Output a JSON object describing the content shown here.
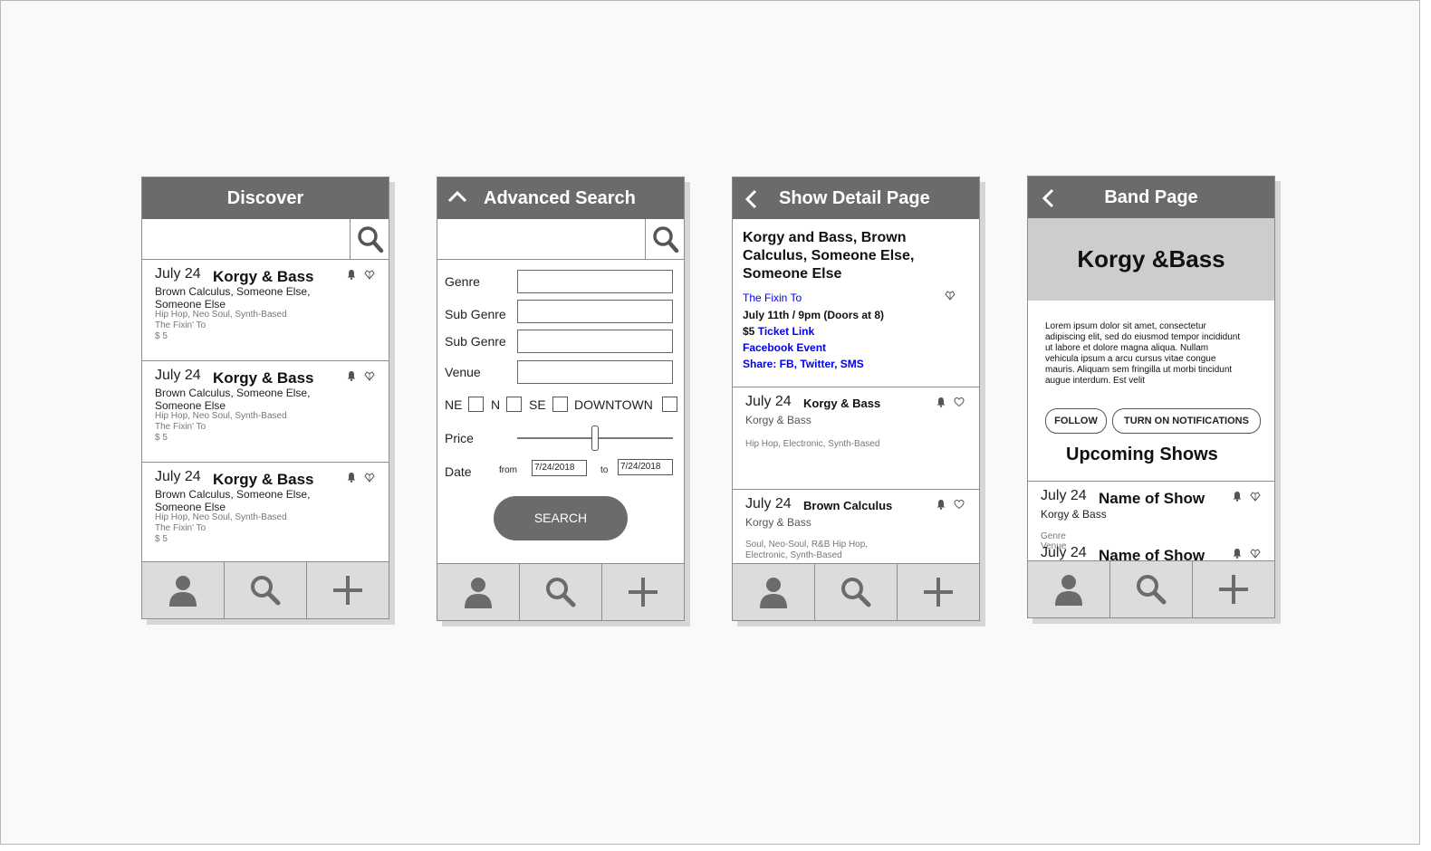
{
  "icons": {
    "search": "search-icon",
    "user": "user-icon",
    "add": "plus-icon",
    "bell": "bell-icon",
    "heart": "heart-icon",
    "back": "chevron-left-icon",
    "collapse": "chevron-up-icon"
  },
  "colors": {
    "header": "#6b6b6b",
    "navbar": "#dcdcdc",
    "link": "#0000ee",
    "band_banner": "#cdcdcd"
  },
  "discover": {
    "title": "Discover",
    "events": [
      {
        "date": "July 24",
        "name": "Korgy & Bass",
        "artists": "Brown Calculus, Someone Else, Someone Else",
        "genres": "Hip Hop, Neo Soul, Synth-Based",
        "venue": "The Fixin' To",
        "price": "$ 5"
      },
      {
        "date": "July 24",
        "name": "Korgy & Bass",
        "artists": "Brown Calculus, Someone Else, Someone Else",
        "genres": "Hip Hop, Neo Soul, Synth-Based",
        "venue": "The Fixin' To",
        "price": "$ 5"
      },
      {
        "date": "July 24",
        "name": "Korgy & Bass",
        "artists": "Brown Calculus, Someone Else, Someone Else",
        "genres": "Hip Hop, Neo Soul, Synth-Based",
        "venue": "The Fixin' To",
        "price": "$ 5"
      }
    ]
  },
  "advanced": {
    "title": "Advanced Search",
    "genre_label": "Genre",
    "subgenre_label": "Sub Genre",
    "subgenre2_label": "Sub Genre",
    "venue_label": "Venue",
    "neighborhoods": [
      "NE",
      "N",
      "SE",
      "DOWNTOWN"
    ],
    "price_label": "Price",
    "price_value": 0.5,
    "date_label": "Date",
    "from_label": "from",
    "to_label": "to",
    "from_value": "7/24/2018",
    "to_value": "7/24/2018",
    "search_label": "SEARCH"
  },
  "detail": {
    "title": "Show Detail Page",
    "show_title": "Korgy and Bass, Brown Calculus, Someone Else, Someone Else",
    "venue": "The Fixin To",
    "datetime": "July 11th / 9pm (Doors at 8)",
    "price": "$5",
    "ticket_link": "Ticket Link",
    "facebook": "Facebook Event",
    "share": "Share: FB, Twitter, SMS",
    "related": [
      {
        "date": "July 24",
        "name": "Korgy & Bass",
        "band": "Korgy & Bass",
        "genres": "Hip Hop, Electronic, Synth-Based"
      },
      {
        "date": "July 24",
        "name": "Brown Calculus",
        "band": "Korgy & Bass",
        "genres": "Soul, Neo-Soul,  R&B Hip Hop, Electronic, Synth-Based"
      }
    ]
  },
  "band": {
    "title": "Band Page",
    "band_name": "Korgy &Bass",
    "bio": "Lorem ipsum dolor sit amet, consectetur adipiscing elit, sed do eiusmod tempor incididunt ut labore et dolore magna aliqua. Nullam vehicula ipsum a arcu cursus vitae congue mauris. Aliquam sem fringilla ut morbi tincidunt augue interdum. Est velit",
    "follow_label": "FOLLOW",
    "notify_label": "TURN ON NOTIFICATIONS",
    "upcoming_label": "Upcoming Shows",
    "shows": [
      {
        "date": "July 24",
        "name": "Name of Show",
        "band": "Korgy & Bass",
        "genre": "Genre",
        "venue": "Venue"
      },
      {
        "date": "July 24",
        "name": "Name of Show"
      }
    ]
  }
}
